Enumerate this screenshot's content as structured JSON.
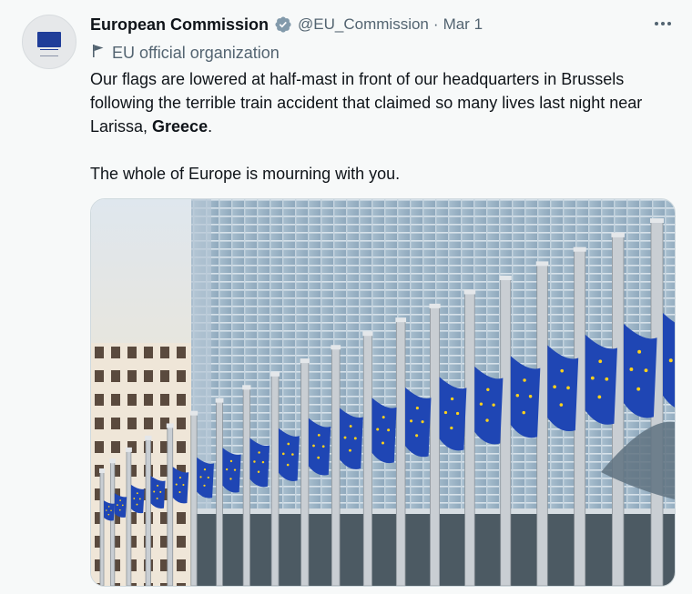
{
  "tweet": {
    "author_name": "European Commission",
    "handle": "@EU_Commission",
    "separator": "·",
    "date": "Mar 1",
    "affiliation": "EU official organization",
    "text_line1_before": "Our flags are lowered at half-mast in front of our headquarters in Brussels following the terrible train accident that claimed so many lives last night near Larissa, ",
    "text_bold": "Greece",
    "text_line1_after": ".",
    "text_paragraph2": "The whole of Europe is mourning with you.",
    "verified_color": "#829aab",
    "flag_color": "#1f46b4",
    "star_color": "#ffd21a"
  },
  "icons": {
    "verified": "verified-badge-icon",
    "affiliation": "flag-icon",
    "more": "more-icon",
    "avatar": "eu-flag-logo"
  }
}
